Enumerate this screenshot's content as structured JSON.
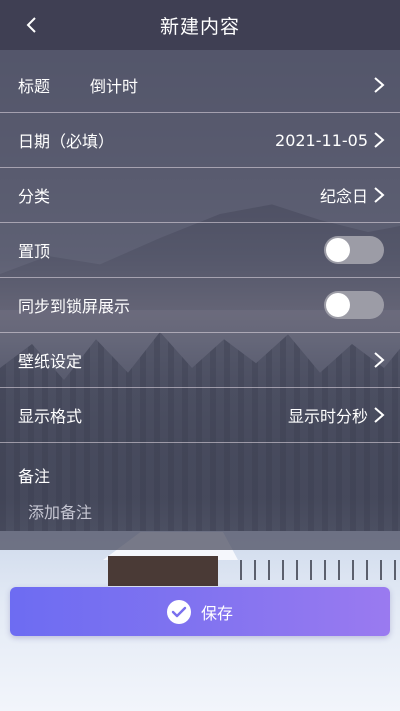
{
  "header": {
    "title": "新建内容",
    "back_icon": "chevron-left-icon"
  },
  "rows": {
    "title": {
      "label": "标题",
      "value": "倒计时"
    },
    "date": {
      "label": "日期（必填）",
      "value": "2021-11-05"
    },
    "category": {
      "label": "分类",
      "value": "纪念日"
    },
    "pin": {
      "label": "置顶",
      "enabled": false
    },
    "sync_lock": {
      "label": "同步到锁屏展示",
      "enabled": false
    },
    "wallpaper": {
      "label": "壁纸设定"
    },
    "display_format": {
      "label": "显示格式",
      "value": "显示时分秒"
    }
  },
  "notes": {
    "label": "备注",
    "placeholder": "添加备注"
  },
  "save": {
    "label": "保存",
    "icon": "check-circle-icon"
  },
  "colors": {
    "header_bg": "#3e3e52",
    "save_gradient_start": "#6d6cf2",
    "save_gradient_end": "#9a7af0",
    "toggle_off": "#9c9ca6"
  }
}
